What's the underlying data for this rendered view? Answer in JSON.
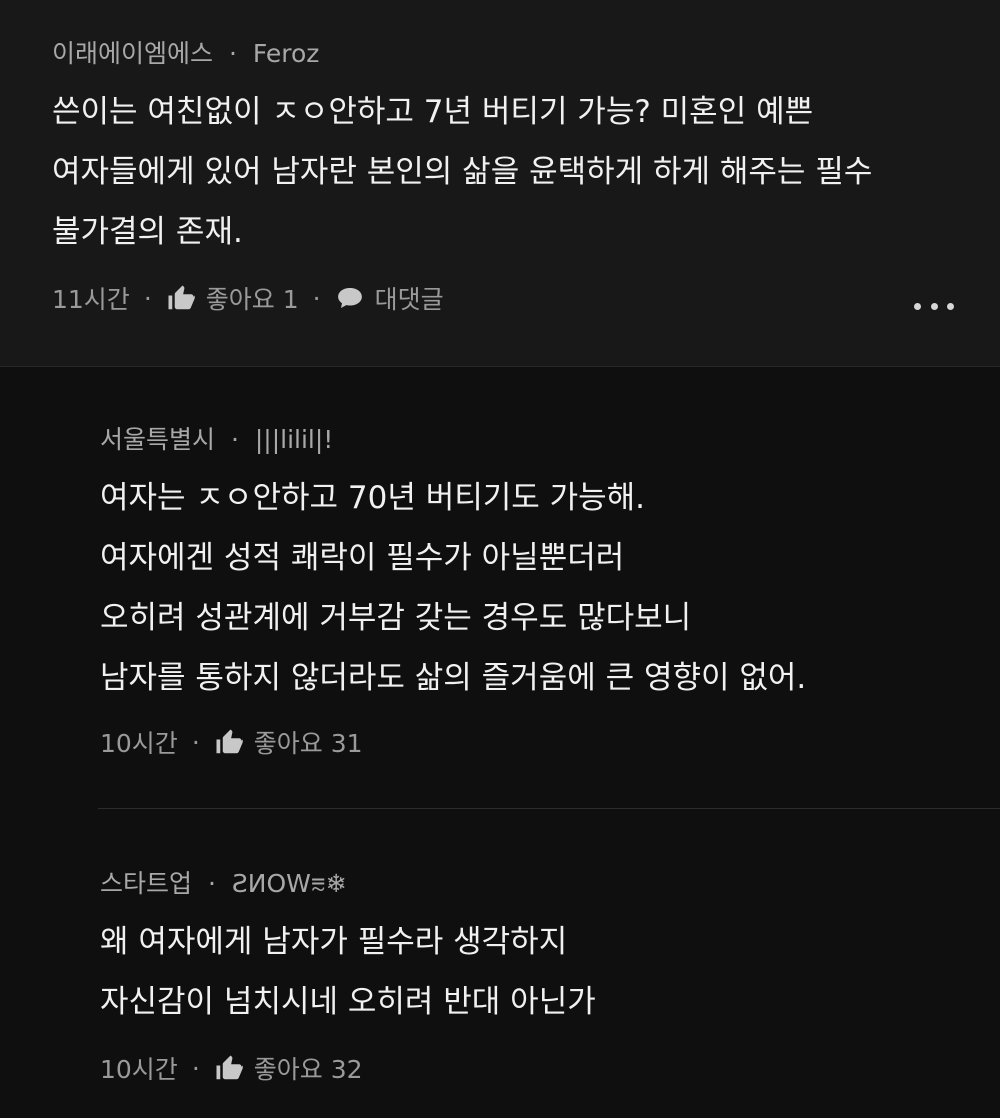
{
  "comments": [
    {
      "location": "이래에이엠에스",
      "separator": "·",
      "nickname": "Feroz",
      "lines": [
        "쓴이는 여친없이 ㅈㅇ안하고 7년 버티기 가능? 미혼인 예쁜",
        "여자들에게 있어 남자란 본인의 삶을 윤택하게 하게 해주는 필수",
        "불가결의 존재."
      ],
      "time": "11시간",
      "like_label": "좋아요 1",
      "reply_label": "대댓글",
      "more_icon": "more-horizontal-icon"
    },
    {
      "location": "서울특별시",
      "separator": "·",
      "nickname": "|||lilil|!",
      "lines": [
        "여자는 ㅈㅇ안하고 70년 버티기도 가능해.",
        "여자에겐 성적 쾌락이 필수가 아닐뿐더러",
        "오히려 성관계에 거부감 갖는 경우도 많다보니",
        "남자를 통하지 않더라도 삶의 즐거움에 큰 영향이 없어."
      ],
      "time": "10시간",
      "like_label": "좋아요 31"
    },
    {
      "location": "스타트업",
      "separator": "·",
      "nickname": "ƧИOW⩳❄",
      "lines": [
        "왜 여자에게 남자가 필수라 생각하지",
        "자신감이 넘치시네 오히려 반대 아닌가"
      ],
      "time": "10시간",
      "like_label": "좋아요 32"
    }
  ],
  "dot": "·",
  "colors": {
    "background": "#0f0f0f",
    "highlight_bg": "#181818",
    "text": "#f1f1f1",
    "meta": "#a8a8a8"
  }
}
